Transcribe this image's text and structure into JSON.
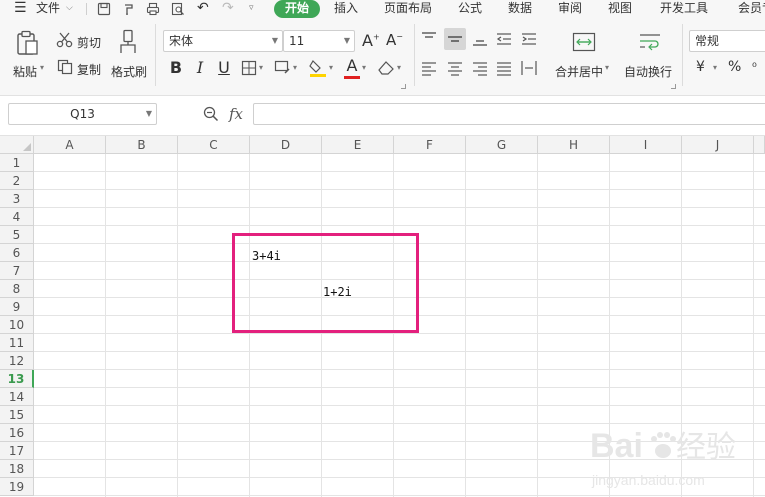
{
  "menu": {
    "file_label": "文件",
    "tabs": [
      "开始",
      "插入",
      "页面布局",
      "公式",
      "数据",
      "审阅",
      "视图",
      "开发工具",
      "会员专"
    ]
  },
  "ribbon": {
    "paste_label": "粘贴",
    "cut_label": "剪切",
    "copy_label": "复制",
    "format_painter_label": "格式刷",
    "font_name": "宋体",
    "font_size": "11",
    "merge_center_label": "合并居中",
    "wrap_text_label": "自动换行",
    "number_format": "常规",
    "currency_symbol": "¥",
    "percent_symbol": "%"
  },
  "formula_bar": {
    "name_box": "Q13",
    "fx_label": "fx",
    "formula": ""
  },
  "sheet": {
    "columns": [
      "A",
      "B",
      "C",
      "D",
      "E",
      "F",
      "G",
      "H",
      "I",
      "J"
    ],
    "rows": [
      "1",
      "2",
      "3",
      "4",
      "5",
      "6",
      "7",
      "8",
      "9",
      "10",
      "11",
      "12",
      "13",
      "14",
      "15",
      "16",
      "17",
      "18",
      "19"
    ],
    "active_row": "13",
    "cells": {
      "D6": "3+4i",
      "E8": "1+2i"
    }
  },
  "colors": {
    "accent_green": "#3fa757",
    "highlight_pink": "#e3207d"
  }
}
